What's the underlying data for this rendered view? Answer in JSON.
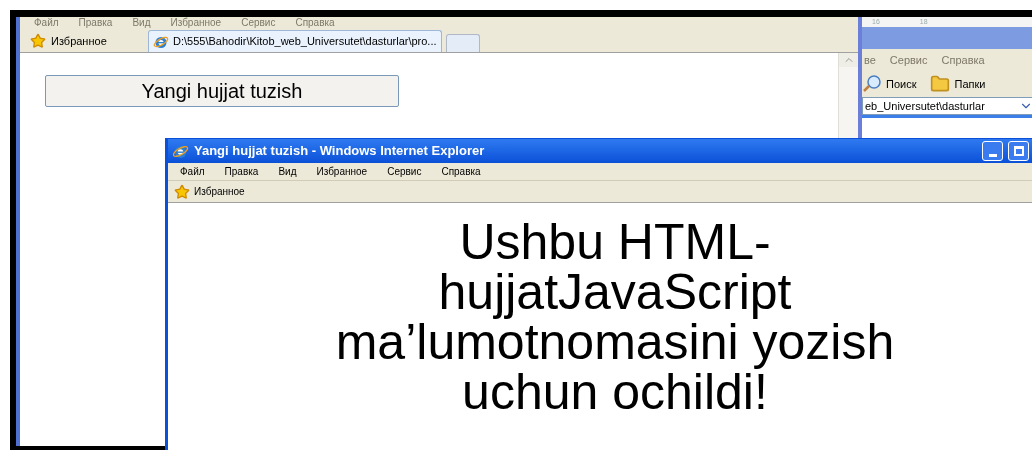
{
  "back_window": {
    "ruler_labels": [
      "16",
      "18"
    ],
    "menu": [
      "ве",
      "Сервис",
      "Справка"
    ],
    "toolbar": [
      {
        "kind": "search",
        "label": "Поиск"
      },
      {
        "kind": "folders",
        "label": "Папки"
      }
    ],
    "address": "eb_Universutet\\dasturlar"
  },
  "main_window": {
    "menu": [
      "Файл",
      "Правка",
      "Вид",
      "Избранное",
      "Сервис",
      "Справка"
    ],
    "favorites": "Избранное",
    "tabs": [
      {
        "label": "D:\\555\\Bahodir\\Kitob_web_Universutet\\dasturlar\\pro...",
        "selected": true
      }
    ],
    "button": "Yangi hujjat tuzish"
  },
  "popup": {
    "title": "Yangi hujjat tuzish - Windows Internet Explorer",
    "menu": [
      "Файл",
      "Правка",
      "Вид",
      "Избранное",
      "Сервис",
      "Справка"
    ],
    "favorites": "Избранное",
    "message": "Ushbu HTML-hujjatJavaScript ma’lumotnomasini yozish uchun ochildi!"
  }
}
